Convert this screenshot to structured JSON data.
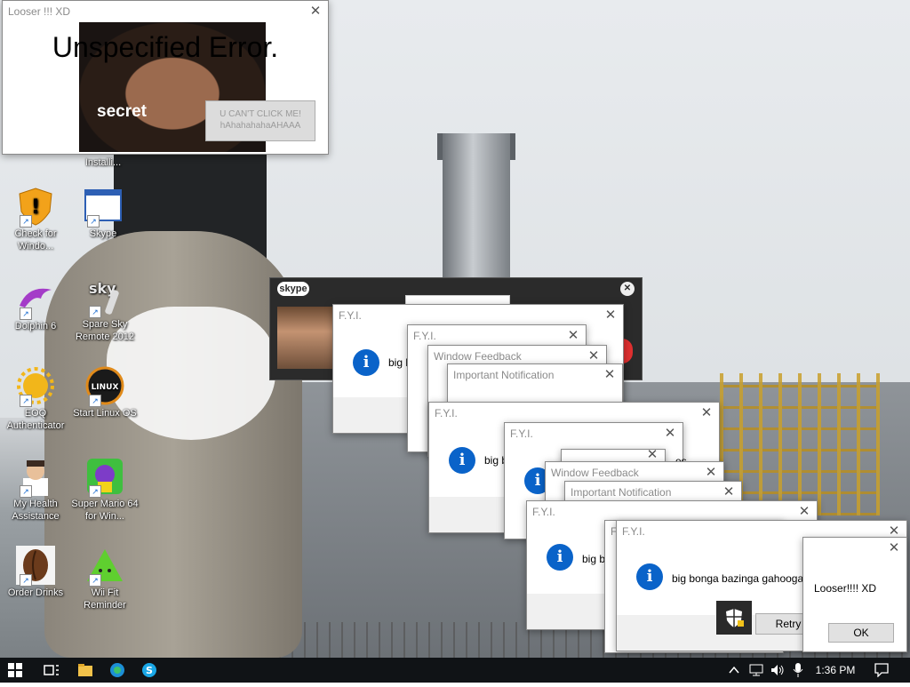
{
  "error_window": {
    "title": "Looser !!! XD",
    "heading": "Unspecified Error.",
    "secret_label": "secret",
    "button_label": "U CAN'T CLICK ME! hAhahahahaAHAAA"
  },
  "desktop_icons": [
    {
      "label": "Installi...",
      "icon": "installer-icon"
    },
    {
      "label": "Check for Windo...",
      "icon": "shield-warning-icon"
    },
    {
      "label": "Skype",
      "icon": "window-icon"
    },
    {
      "label": "Dolphin 6",
      "icon": "dolphin-icon"
    },
    {
      "label": "Spare Sky Remote 2012",
      "icon": "sky-remote-icon"
    },
    {
      "label": "EOQ Authenticator",
      "icon": "sun-icon"
    },
    {
      "label": "Start Linux OS",
      "icon": "linux-icon"
    },
    {
      "label": "My Health Assistance",
      "icon": "doctor-icon"
    },
    {
      "label": "Super Mario 64 for Win...",
      "icon": "mario-icon"
    },
    {
      "label": "Order Drinks",
      "icon": "coffee-bean-icon"
    },
    {
      "label": "Wii Fit Reminder",
      "icon": "triangle-icon"
    }
  ],
  "skype_window": {
    "logo": "skype"
  },
  "dialogs": {
    "fyi_title": "F.Y.I.",
    "feedback_title": "Window Feedback",
    "important_title": "Important Notification",
    "partial_message": "big b",
    "full_message": "big bonga bazinga gahooga",
    "partial_es": "es",
    "retry_label": "Retry",
    "looser_message": "Looser!!!! XD",
    "ok_label": "OK",
    "partial_f": "F"
  },
  "taskbar": {
    "time": "1:36 PM",
    "icons": [
      "windows-start-icon",
      "task-view-icon",
      "file-explorer-icon",
      "edge-icon",
      "skype-icon"
    ],
    "tray_icons": [
      "chevron-up-icon",
      "network-icon",
      "volume-icon",
      "microphone-icon",
      "notification-icon"
    ]
  },
  "colors": {
    "info_blue": "#0a63c9",
    "taskbar": "#101316",
    "skype_bar": "#2b2b2b"
  }
}
